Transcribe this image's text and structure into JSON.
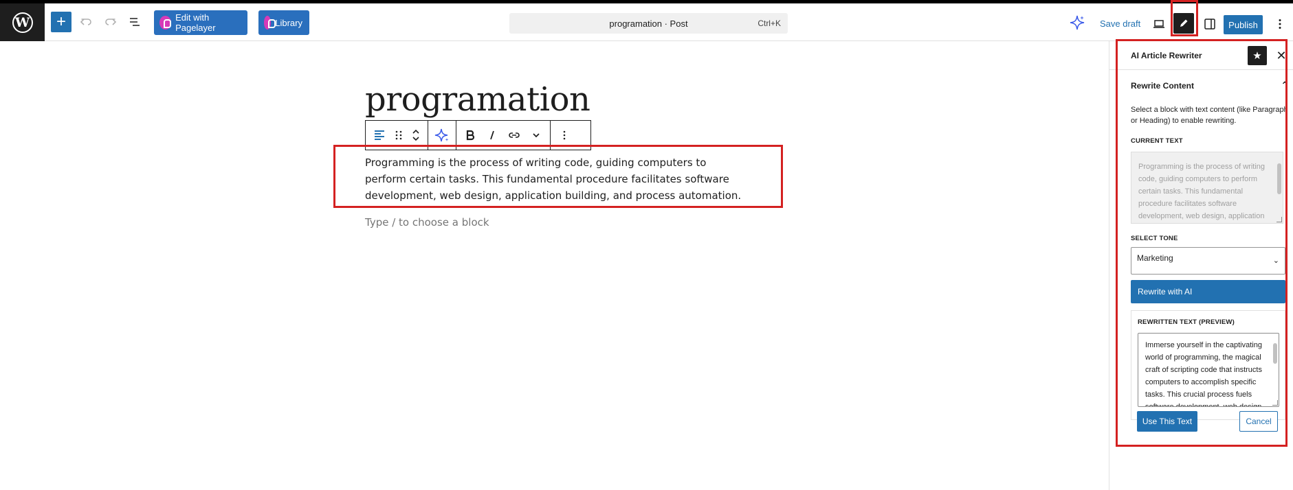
{
  "toolbar": {
    "logo_letter": "W",
    "add_symbol": "+",
    "edit_pagelayer": "Edit with Pagelayer",
    "library": "Library",
    "doc_title": "programation · Post",
    "shortcut": "Ctrl+K",
    "save_draft": "Save draft",
    "publish": "Publish"
  },
  "editor": {
    "post_title": "programation",
    "paragraph": "Programming is the process of writing code, guiding computers to perform certain tasks. This fundamental procedure facilitates software development, web design, application building, and process automation.",
    "placeholder": "Type / to choose a block"
  },
  "sidebar": {
    "title": "AI Article Rewriter",
    "panel_title": "Rewrite Content",
    "help_text": "Select a block with text content (like Paragraph or Heading) to enable rewriting.",
    "current_label": "CURRENT TEXT",
    "current_text": "Programming is the process of writing code, guiding computers to perform certain tasks. This fundamental procedure facilitates software development, web design, application building, and process automation.",
    "tone_label": "SELECT TONE",
    "tone_value": "Marketing",
    "rewrite_button": "Rewrite with AI",
    "preview_label": "REWRITTEN TEXT (PREVIEW)",
    "preview_text": "Immerse yourself in the captivating world of programming, the magical craft of scripting code that instructs computers to accomplish specific tasks. This crucial process fuels software development, web design and app creation.",
    "use_button": "Use This Text",
    "cancel_button": "Cancel"
  },
  "colors": {
    "accent": "#2271b1",
    "highlight": "#d42121",
    "dark": "#1e1e1e"
  }
}
